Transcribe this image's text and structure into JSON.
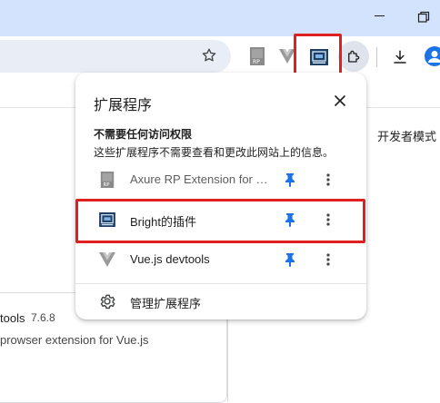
{
  "colors": {
    "accent_pin": "#1a73e8",
    "highlight": "#e02020",
    "titlebar": "#d3e3fd"
  },
  "toolbar": {
    "icons": [
      "star-icon",
      "axure-rp-icon",
      "vue-icon",
      "bright-extension-icon",
      "puzzle-icon",
      "download-icon",
      "profile-icon"
    ]
  },
  "page": {
    "developer_mode": "开发者模式",
    "extension_card": {
      "name": "tools",
      "version": "7.6.8",
      "description": "prowser extension for Vue.js"
    }
  },
  "popup": {
    "title": "扩展程序",
    "section_title": "不需要任何访问权限",
    "section_desc": "这些扩展程序不需要查看和更改此网站上的信息。",
    "extensions": [
      {
        "name": "Axure RP Extension for Chrome",
        "pinned": true,
        "icon": "axure-rp-icon"
      },
      {
        "name": "Bright的插件",
        "pinned": true,
        "icon": "bright-extension-icon"
      },
      {
        "name": "Vue.js devtools",
        "pinned": true,
        "icon": "vue-icon"
      }
    ],
    "manage_label": "管理扩展程序"
  }
}
